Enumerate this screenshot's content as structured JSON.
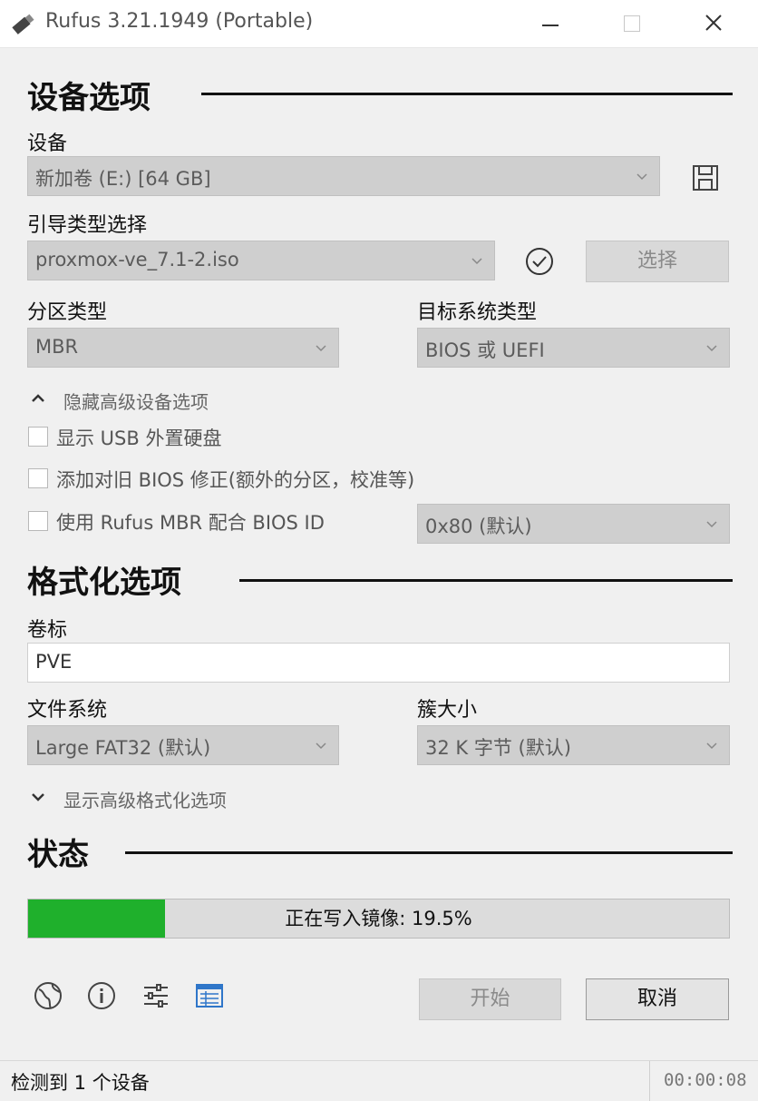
{
  "window": {
    "title": "Rufus 3.21.1949 (Portable)"
  },
  "device_options": {
    "header": "设备选项",
    "device_label": "设备",
    "device_value": "新加卷 (E:) [64 GB]",
    "boot_label": "引导类型选择",
    "boot_value": "proxmox-ve_7.1-2.iso",
    "select_button": "选择",
    "partition_label": "分区类型",
    "partition_value": "MBR",
    "target_label": "目标系统类型",
    "target_value": "BIOS 或 UEFI",
    "advanced_toggle": "隐藏高级设备选项",
    "list_usb": "显示 USB 外置硬盘",
    "old_bios": "添加对旧 BIOS 修正(额外的分区，校准等)",
    "rufus_mbr": "使用 Rufus MBR 配合 BIOS ID",
    "bios_id_value": "0x80 (默认)"
  },
  "format_options": {
    "header": "格式化选项",
    "volume_label": "卷标",
    "volume_value": "PVE",
    "fs_label": "文件系统",
    "fs_value": "Large FAT32 (默认)",
    "cluster_label": "簇大小",
    "cluster_value": "32 K 字节 (默认)",
    "advanced_toggle": "显示高级格式化选项"
  },
  "status": {
    "header": "状态",
    "progress_text": "正在写入镜像: 19.5%",
    "progress_fraction": 0.195,
    "progress_color": "#1fb02c",
    "start_button": "开始",
    "cancel_button": "取消"
  },
  "toolbar_icons": [
    "globe-icon",
    "info-icon",
    "settings-icon",
    "log-icon"
  ],
  "statusbar": {
    "text": "检测到 1 个设备",
    "timer": "00:00:08"
  }
}
